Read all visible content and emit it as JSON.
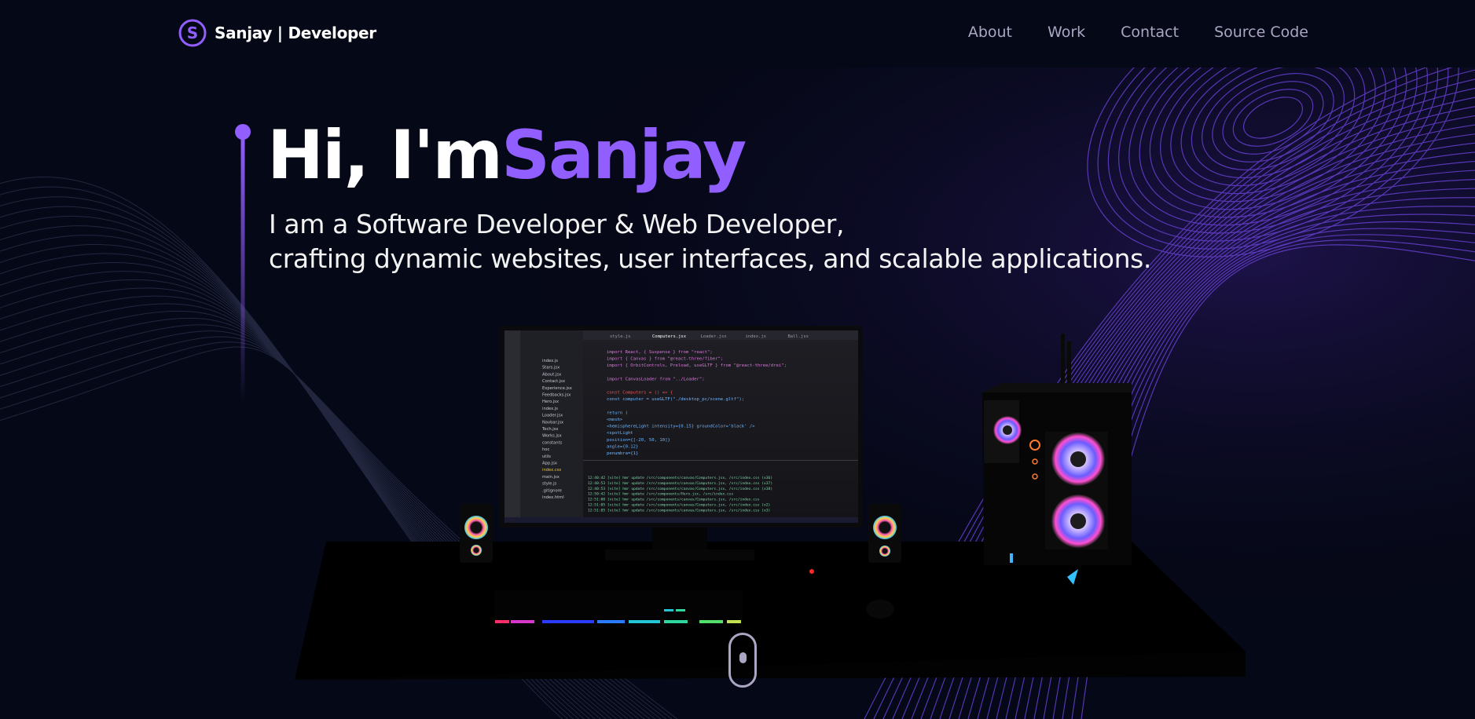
{
  "navbar": {
    "brand_name": "Sanjay | Developer",
    "logo_letter": "S",
    "links": [
      {
        "label": "About"
      },
      {
        "label": "Work"
      },
      {
        "label": "Contact"
      },
      {
        "label": "Source Code"
      }
    ]
  },
  "hero": {
    "title_prefix": "Hi, I'm",
    "title_name": "Sanjay",
    "subtitle_line1": "I am a Software Developer & Web Developer,",
    "subtitle_line2": "crafting dynamic websites, user interfaces, and scalable applications."
  },
  "scene": {
    "monitor_code_lines": [
      "import React, { Suspense } from \"react\";",
      "import { Canvas } from \"@react-three/fiber\";",
      "import { OrbitControls, Preload, useGLTF } from \"@react-three/drei\";",
      "",
      "import CanvasLoader from \"../Loader\";",
      "",
      "const Computers = () => {",
      "  const computer = useGLTF(\"./desktop_pc/scene.gltf\");",
      "",
      "  return (",
      "    <mesh>",
      "      <hemisphereLight intensity={0.15} groundColor='black' />",
      "      <spotLight",
      "        position={[-20, 50, 10]}",
      "        angle={0.12}",
      "        penumbra={1}"
    ],
    "monitor_files": [
      "index.js",
      "Stars.jsx",
      "About.jsx",
      "Contact.jsx",
      "Experience.jsx",
      "Feedbacks.jsx",
      "Hero.jsx",
      "index.js",
      "Loader.jsx",
      "Navbar.jsx",
      "Tech.jsx",
      "Works.jsx",
      "constants",
      "hoc",
      "utils",
      "App.jsx",
      "index.css",
      "main.jsx",
      "style.js",
      ".gitignore",
      "index.html"
    ],
    "monitor_tabs": [
      "style.js",
      "Computers.jsx",
      "Loader.jsx",
      "index.js",
      "Ball.jsx"
    ],
    "terminal_lines": [
      "12:40:42 [vite] hmr update /src/components/canvas/Computers.jsx, /src/index.css (x36)",
      "12:40:53 [vite] hmr update /src/components/canvas/Computers.jsx, /src/index.css (x37)",
      "12:40:53 [vite] hmr update /src/components/canvas/Computers.jsx, /src/index.css (x38)",
      "12:50:42 [vite] hmr update /src/components/Hero.jsx, /src/index.css",
      "12:51:00 [vite] hmr update /src/components/canvas/Computers.jsx, /src/index.css",
      "12:51:05 [vite] hmr update /src/components/canvas/Computers.jsx, /src/index.css (x2)",
      "12:51:05 [vite] hmr update /src/components/canvas/Computers.jsx, /src/index.css (x3)"
    ]
  },
  "colors": {
    "background": "#050816",
    "accent": "#915eff",
    "nav_text": "#aaa6c3",
    "white": "#ffffff"
  }
}
